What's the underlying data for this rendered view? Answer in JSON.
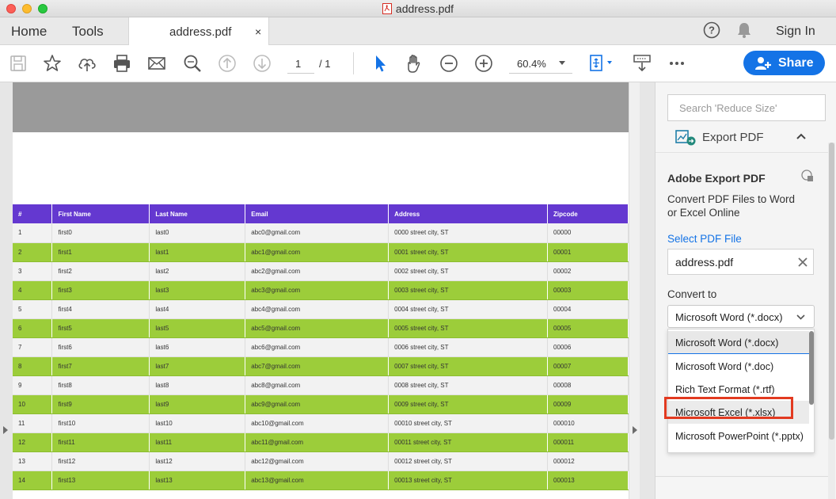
{
  "window": {
    "title": "address.pdf"
  },
  "tabs": {
    "home": "Home",
    "tools": "Tools",
    "document": "address.pdf",
    "close": "×"
  },
  "header_actions": {
    "sign_in": "Sign In"
  },
  "toolbar": {
    "page_current": "1",
    "page_total": "/ 1",
    "zoom": "60.4%",
    "share": "Share"
  },
  "table": {
    "columns": [
      "#",
      "First Name",
      "Last Name",
      "Email",
      "Address",
      "Zipcode"
    ],
    "rows": [
      [
        "1",
        "first0",
        "last0",
        "abc0@gmail.com",
        "0000 street city, ST",
        "00000"
      ],
      [
        "2",
        "first1",
        "last1",
        "abc1@gmail.com",
        "0001 street city, ST",
        "00001"
      ],
      [
        "3",
        "first2",
        "last2",
        "abc2@gmail.com",
        "0002 street city, ST",
        "00002"
      ],
      [
        "4",
        "first3",
        "last3",
        "abc3@gmail.com",
        "0003 street city, ST",
        "00003"
      ],
      [
        "5",
        "first4",
        "last4",
        "abc4@gmail.com",
        "0004 street city, ST",
        "00004"
      ],
      [
        "6",
        "first5",
        "last5",
        "abc5@gmail.com",
        "0005 street city, ST",
        "00005"
      ],
      [
        "7",
        "first6",
        "last6",
        "abc6@gmail.com",
        "0006 street city, ST",
        "00006"
      ],
      [
        "8",
        "first7",
        "last7",
        "abc7@gmail.com",
        "0007 street city, ST",
        "00007"
      ],
      [
        "9",
        "first8",
        "last8",
        "abc8@gmail.com",
        "0008 street city, ST",
        "00008"
      ],
      [
        "10",
        "first9",
        "last9",
        "abc9@gmail.com",
        "0009 street city, ST",
        "00009"
      ],
      [
        "11",
        "first10",
        "last10",
        "abc10@gmail.com",
        "00010 street city, ST",
        "000010"
      ],
      [
        "12",
        "first11",
        "last11",
        "abc11@gmail.com",
        "00011 street city, ST",
        "000011"
      ],
      [
        "13",
        "first12",
        "last12",
        "abc12@gmail.com",
        "00012 street city, ST",
        "000012"
      ],
      [
        "14",
        "first13",
        "last13",
        "abc13@gmail.com",
        "00013 street city, ST",
        "000013"
      ]
    ]
  },
  "panel": {
    "search_placeholder": "Search 'Reduce Size'",
    "section_title": "Export PDF",
    "card_title": "Adobe Export PDF",
    "card_desc_line1": "Convert PDF Files to Word",
    "card_desc_line2": "or Excel Online",
    "select_file_label": "Select PDF File",
    "selected_file": "address.pdf",
    "convert_to_label": "Convert to",
    "convert_selected": "Microsoft Word (*.docx)",
    "convert_options": [
      "Microsoft Word (*.docx)",
      "Microsoft Word (*.doc)",
      "Rich Text Format (*.rtf)",
      "Microsoft Excel (*.xlsx)",
      "Microsoft PowerPoint (*.pptx)"
    ]
  },
  "colors": {
    "accent": "#1473e6",
    "table_header": "#6438d0",
    "row_highlight": "#9ccd3a",
    "annotation": "#e23a20"
  }
}
